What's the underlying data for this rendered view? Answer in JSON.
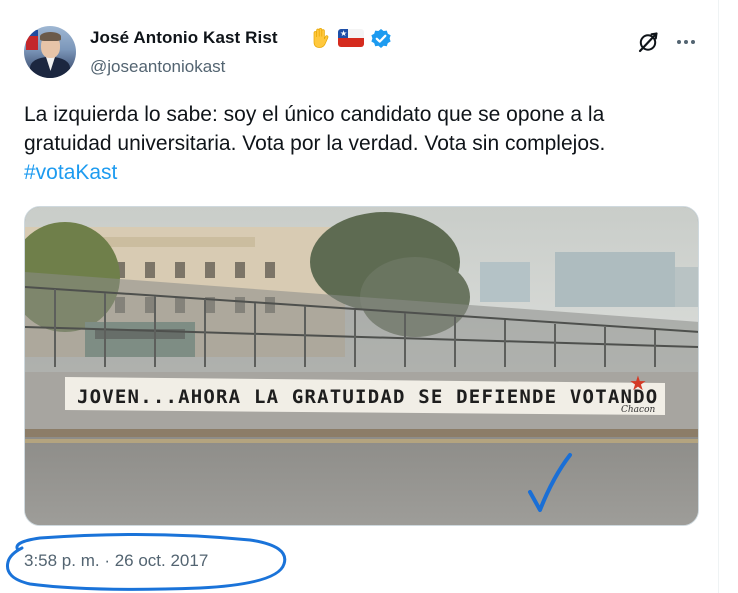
{
  "author": {
    "name": "José Antonio Kast Rist",
    "handle": "@joseantoniokast",
    "hand_emoji": "raised-hand-emoji",
    "flag_emoji": "chile-flag-emoji",
    "verified": true
  },
  "tweet": {
    "text_line1": "La izquierda lo sabe: soy el único candidato que se opone a la",
    "text_line2": "gratuidad universitaria. Vota por la verdad. Vota sin complejos.",
    "hashtag": "#votaKast"
  },
  "media": {
    "banner_text": "JOVEN...AHORA LA GRATUIDAD SE DEFIENDE VOTANDO",
    "signature": "Chacon"
  },
  "meta": {
    "timestamp": "3:58 p. m. · 26 oct. 2017"
  },
  "icons": {
    "grok": "grok-icon",
    "more": "more-icon"
  },
  "colors": {
    "text": "#0f1419",
    "secondary": "#536471",
    "link": "#1d9bf0",
    "verified": "#1d9bf0",
    "annotation": "#1a73d9"
  }
}
